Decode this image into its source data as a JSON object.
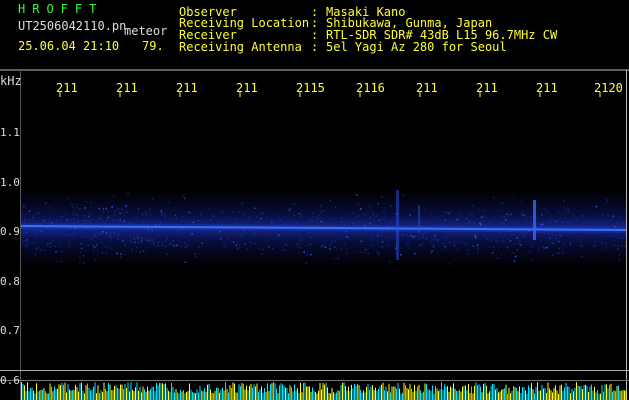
{
  "header": {
    "app_title": "HROFFT",
    "filename": "UT2506042110.pn",
    "detection_label": "meteor",
    "timestamp": "25.06.04 21:10",
    "count": "79."
  },
  "info": [
    {
      "label": "Observer",
      "sep": ":",
      "value": "Masaki Kano"
    },
    {
      "label": "Receiving Location",
      "sep": ":",
      "value": "Shibukawa, Gunma, Japan"
    },
    {
      "label": "Receiver",
      "sep": ":",
      "value": "RTL-SDR SDR# 43dB L15 96.7MHz CW"
    },
    {
      "label": "Receiving Antenna",
      "sep": ":",
      "value": "5el Yagi Az 280 for Seoul"
    }
  ],
  "axis": {
    "unit": "kHz",
    "x_ticks": [
      "211",
      "211",
      "211",
      "211",
      "2115",
      "2116",
      "211",
      "211",
      "211",
      "2120"
    ],
    "y_ticks": [
      "1.1",
      "1.0",
      "0.9",
      "0.8",
      "0.7",
      "0.6"
    ]
  },
  "colors": {
    "header_yellow": "#ffff33",
    "title_green": "#33ff33",
    "signal_blue": "#3a7bff",
    "noise_blue": "#1a2a9a",
    "bottom_bar": "#ffff00",
    "bottom_cyan": "#00e5ff"
  }
}
